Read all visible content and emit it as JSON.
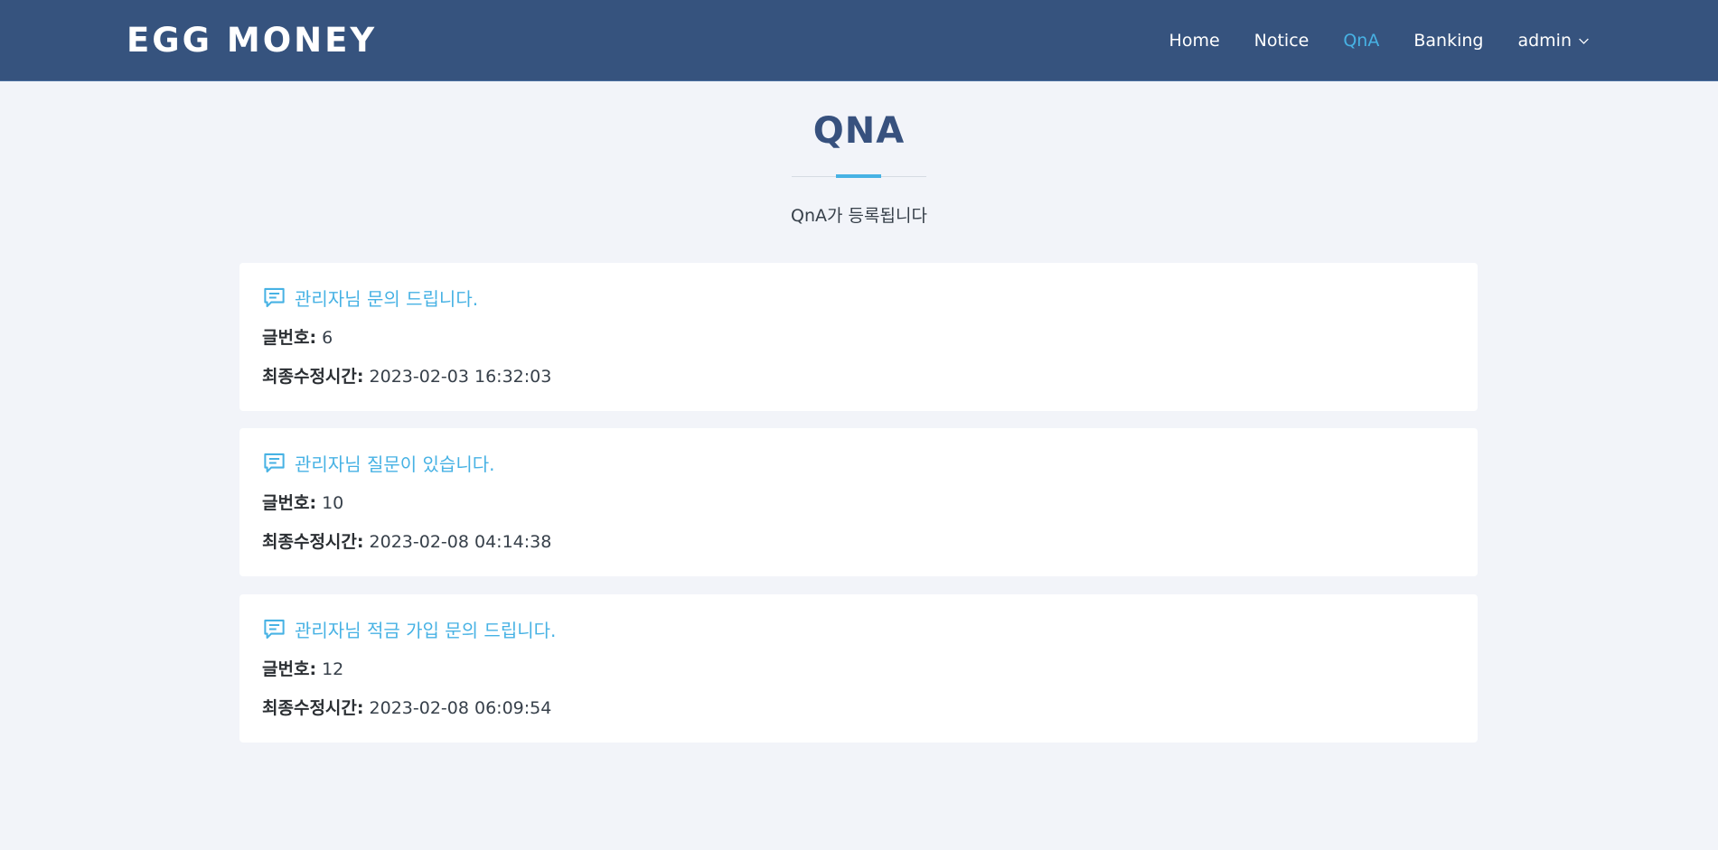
{
  "header": {
    "logo": "EGG MONEY",
    "nav": [
      {
        "label": "Home",
        "active": false
      },
      {
        "label": "Notice",
        "active": false
      },
      {
        "label": "QnA",
        "active": true
      },
      {
        "label": "Banking",
        "active": false
      },
      {
        "label": "admin",
        "active": false,
        "icon": "chevron-down-icon"
      }
    ]
  },
  "section": {
    "title": "QNA",
    "subtitle": "QnA가 등록됩니다"
  },
  "labels": {
    "number": "글번호:",
    "modified": "최종수정시간:"
  },
  "posts": [
    {
      "title": "관리자님 문의 드립니다.",
      "number": "6",
      "modified": "2023-02-03 16:32:03",
      "icon": "chat-text-icon"
    },
    {
      "title": "관리자님 질문이 있습니다.",
      "number": "10",
      "modified": "2023-02-08 04:14:38",
      "icon": "chat-text-icon"
    },
    {
      "title": "관리자님 적금 가입 문의 드립니다.",
      "number": "12",
      "modified": "2023-02-08 06:09:54",
      "icon": "chat-text-icon"
    }
  ],
  "colors": {
    "header_bg": "#36537e",
    "accent": "#47b2e4",
    "page_bg": "#f2f4f9",
    "title": "#37517e"
  }
}
